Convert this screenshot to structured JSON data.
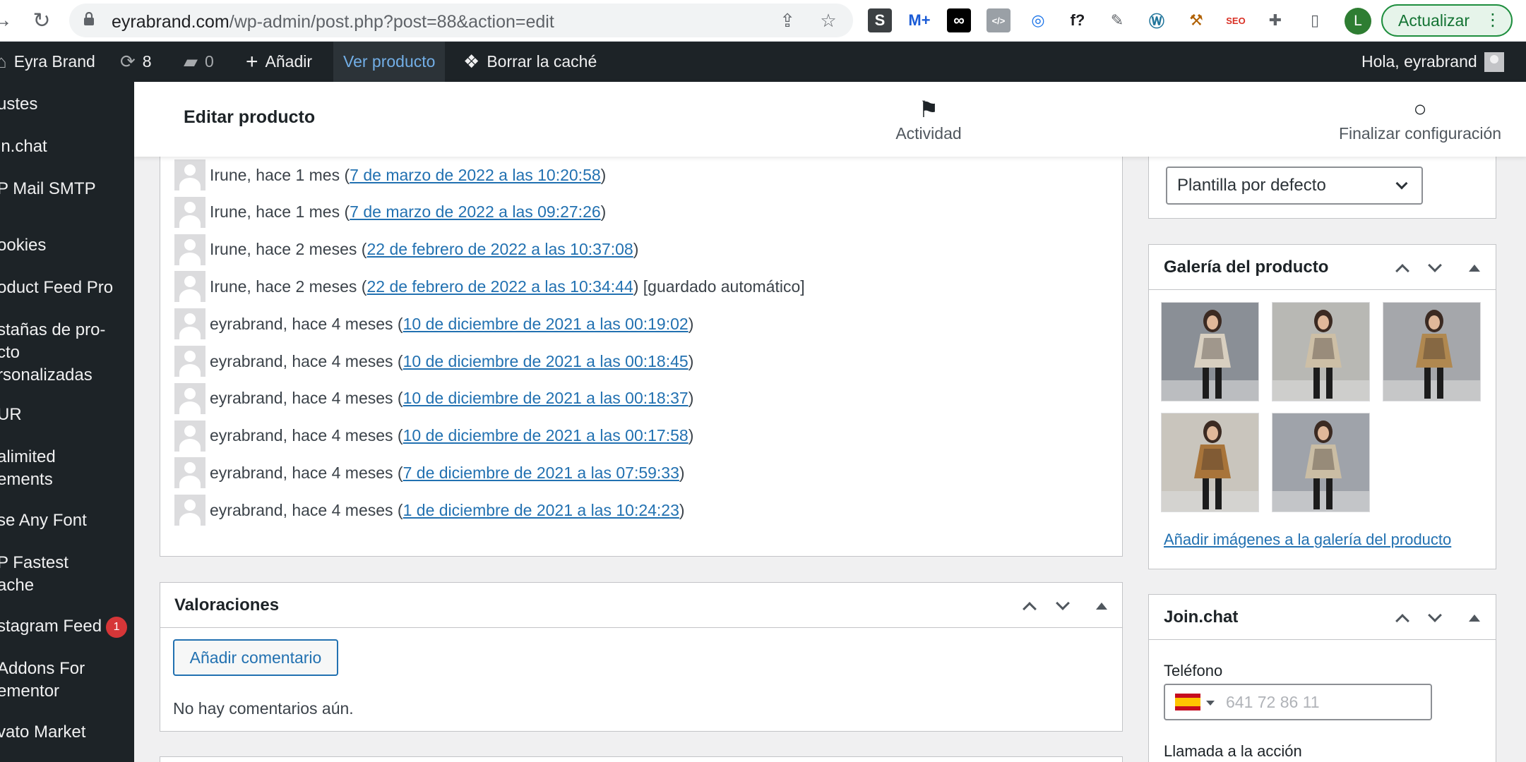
{
  "browser": {
    "url_domain": "eyrabrand.com",
    "url_path": "/wp-admin/post.php?post=88&action=edit",
    "profile_initial": "L",
    "update_label": "Actualizar",
    "extensions": [
      {
        "name": "s-extension-icon",
        "glyph": "S",
        "color": "#ffffff",
        "bg": "#3c4043"
      },
      {
        "name": "movistar-extension-icon",
        "glyph": "M+",
        "color": "#1a5bd6",
        "bg": "transparent"
      },
      {
        "name": "infinity-extension-icon",
        "glyph": "∞",
        "color": "#ffffff",
        "bg": "#000000"
      },
      {
        "name": "code-extension-icon",
        "glyph": "</>",
        "color": "#ffffff",
        "bg": "#9aa0a6"
      },
      {
        "name": "target-extension-icon",
        "glyph": "◎",
        "color": "#1a73e8",
        "bg": "transparent"
      },
      {
        "name": "font-extension-icon",
        "glyph": "f?",
        "color": "#202124",
        "bg": "transparent"
      },
      {
        "name": "eyedropper-extension-icon",
        "glyph": "✎",
        "color": "#5f6368",
        "bg": "transparent"
      },
      {
        "name": "wordpress-extension-icon",
        "glyph": "Ⓦ",
        "color": "#21759b",
        "bg": "transparent"
      },
      {
        "name": "hammer-extension-icon",
        "glyph": "⚒",
        "color": "#b06000",
        "bg": "transparent"
      },
      {
        "name": "seo-extension-icon",
        "glyph": "SEO",
        "color": "#d93025",
        "bg": "transparent"
      },
      {
        "name": "puzzle-extensions-icon",
        "glyph": "✚",
        "color": "#5f6368",
        "bg": "transparent"
      },
      {
        "name": "sidepanel-icon",
        "glyph": "▯",
        "color": "#5f6368",
        "bg": "transparent"
      }
    ]
  },
  "adminbar": {
    "site_name": "Eyra Brand",
    "updates_count": "8",
    "comments_count": "0",
    "add_new": "Añadir",
    "view_product": "Ver producto",
    "clear_cache": "Borrar la caché",
    "greeting": "Hola, eyrabrand"
  },
  "sidebar": {
    "items": [
      {
        "label": "ustes"
      },
      {
        "label": "in.chat"
      },
      {
        "label": "P Mail SMTP"
      },
      {
        "label": "ookies"
      },
      {
        "label": "oduct Feed Pro"
      },
      {
        "label": "stañas de pro-\ncto\nrsonalizadas"
      },
      {
        "label": "UR"
      },
      {
        "label": "alimited\nements"
      },
      {
        "label": "se Any Font"
      },
      {
        "label": "P Fastest\nache"
      },
      {
        "label": "stagram Feed",
        "badge": "1"
      },
      {
        "label": " Addons For\nementor"
      },
      {
        "label": "vato Market"
      }
    ]
  },
  "header": {
    "title": "Editar producto",
    "activity": "Actividad",
    "finish_setup": "Finalizar configuración"
  },
  "revisions": [
    {
      "author": "Irune, hace 1 mes",
      "date": "7 de marzo de 2022 a las 10:20:58",
      "note": ""
    },
    {
      "author": "Irune, hace 1 mes",
      "date": "7 de marzo de 2022 a las 09:27:26",
      "note": ""
    },
    {
      "author": "Irune, hace 2 meses",
      "date": "22 de febrero de 2022 a las 10:37:08",
      "note": ""
    },
    {
      "author": "Irune, hace 2 meses",
      "date": "22 de febrero de 2022 a las 10:34:44",
      "note": " [guardado automático]"
    },
    {
      "author": "eyrabrand, hace 4 meses",
      "date": "10 de diciembre de 2021 a las 00:19:02",
      "note": ""
    },
    {
      "author": "eyrabrand, hace 4 meses",
      "date": "10 de diciembre de 2021 a las 00:18:45",
      "note": ""
    },
    {
      "author": "eyrabrand, hace 4 meses",
      "date": "10 de diciembre de 2021 a las 00:18:37",
      "note": ""
    },
    {
      "author": "eyrabrand, hace 4 meses",
      "date": "10 de diciembre de 2021 a las 00:17:58",
      "note": ""
    },
    {
      "author": "eyrabrand, hace 4 meses",
      "date": "7 de diciembre de 2021 a las 07:59:33",
      "note": ""
    },
    {
      "author": "eyrabrand, hace 4 meses",
      "date": "1 de diciembre de 2021 a las 10:24:23",
      "note": ""
    }
  ],
  "reviews": {
    "title": "Valoraciones",
    "add_comment": "Añadir comentario",
    "empty": "No hay comentarios aún."
  },
  "template": {
    "selected": "Plantilla por defecto"
  },
  "gallery": {
    "title": "Galería del producto",
    "add_link": "Añadir imágenes a la galería del producto",
    "images": [
      {
        "name": "gallery-image-1",
        "bg": "#8a8f96",
        "dress": "#d8cfc0"
      },
      {
        "name": "gallery-image-2",
        "bg": "#b8b8b4",
        "dress": "#cdbfa6"
      },
      {
        "name": "gallery-image-3",
        "bg": "#a5a7ab",
        "dress": "#b08850"
      },
      {
        "name": "gallery-image-4",
        "bg": "#c9c5bd",
        "dress": "#a8743a"
      },
      {
        "name": "gallery-image-5",
        "bg": "#9fa3aa",
        "dress": "#cabda4"
      }
    ]
  },
  "joinchat": {
    "title": "Join.chat",
    "phone_label": "Teléfono",
    "phone_placeholder": "641 72 86 11",
    "cta_label": "Llamada a la acción"
  },
  "colors": {
    "admin_dark": "#1d2327",
    "link": "#2271b1",
    "badge": "#d63638"
  }
}
